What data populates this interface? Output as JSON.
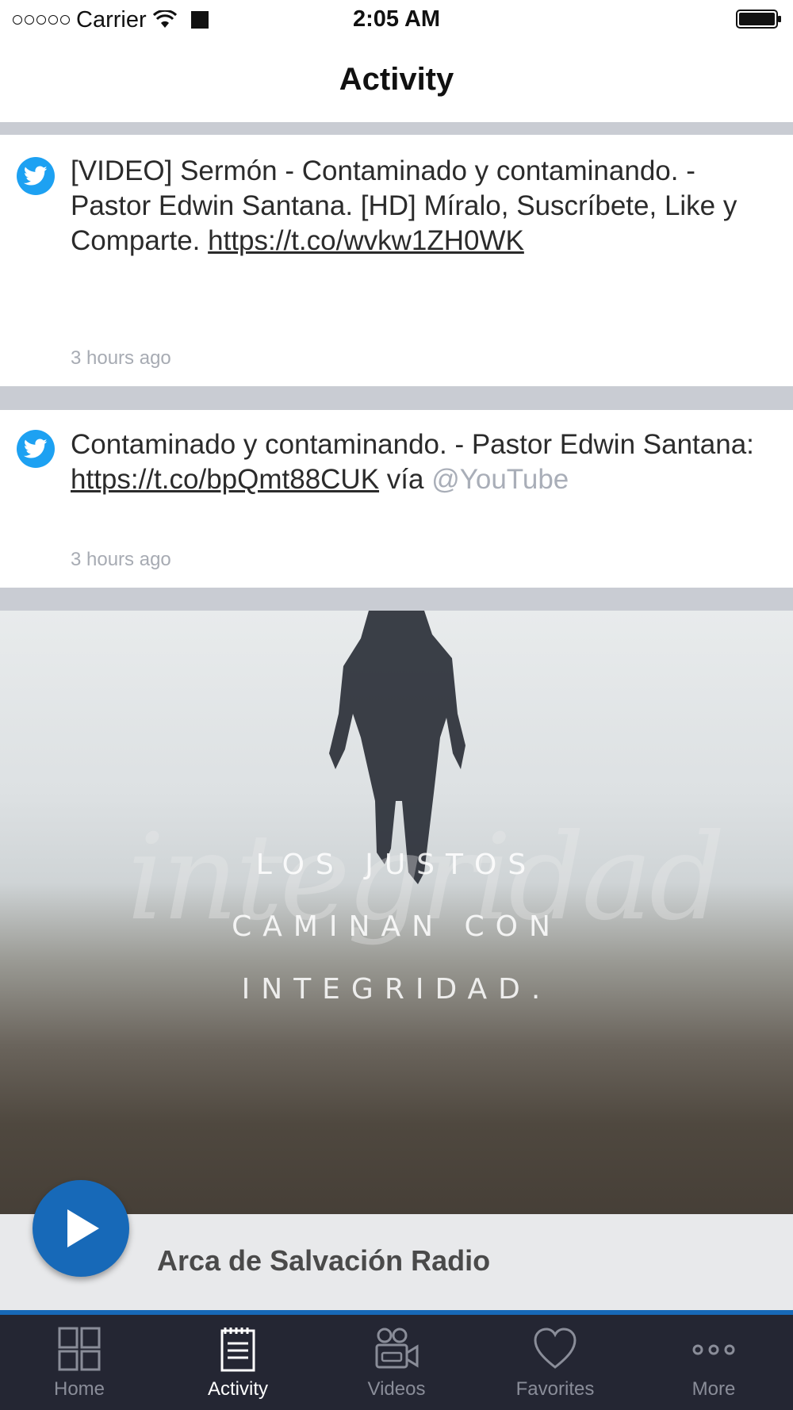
{
  "status_bar": {
    "carrier": "Carrier",
    "time": "2:05 AM"
  },
  "nav": {
    "title": "Activity"
  },
  "feed": [
    {
      "source_icon": "twitter-icon",
      "text_before": "[VIDEO] Sermón - Contaminado y contaminando. - Pastor Edwin Santana. [HD] Míralo, Suscríbete, Like y Comparte. ",
      "link": "https://t.co/wvkw1ZH0WK",
      "time": "3 hours ago"
    },
    {
      "source_icon": "twitter-icon",
      "text_before": "Contaminado y contaminando. - Pastor Edwin Santana: ",
      "link": "https://t.co/bpQmt88CUK",
      "text_after": " vía ",
      "mention": "@YouTube",
      "time": "3 hours ago"
    }
  ],
  "image_card": {
    "line1": "LOS JUSTOS",
    "line2": "CAMINAN CON",
    "line3": "INTEGRIDAD.",
    "script_word": "integridad"
  },
  "player": {
    "title": "Arca de Salvación Radio",
    "play_icon": "play-icon"
  },
  "tabs": [
    {
      "label": "Home",
      "icon": "home-grid-icon",
      "active": false
    },
    {
      "label": "Activity",
      "icon": "activity-notepad-icon",
      "active": true
    },
    {
      "label": "Videos",
      "icon": "video-camera-icon",
      "active": false
    },
    {
      "label": "Favorites",
      "icon": "heart-icon",
      "active": false
    },
    {
      "label": "More",
      "icon": "more-dots-icon",
      "active": false
    }
  ],
  "colors": {
    "accent": "#1769b8",
    "twitter": "#1da1f2",
    "tabbar": "#242633",
    "separator": "#c9ccd3"
  }
}
